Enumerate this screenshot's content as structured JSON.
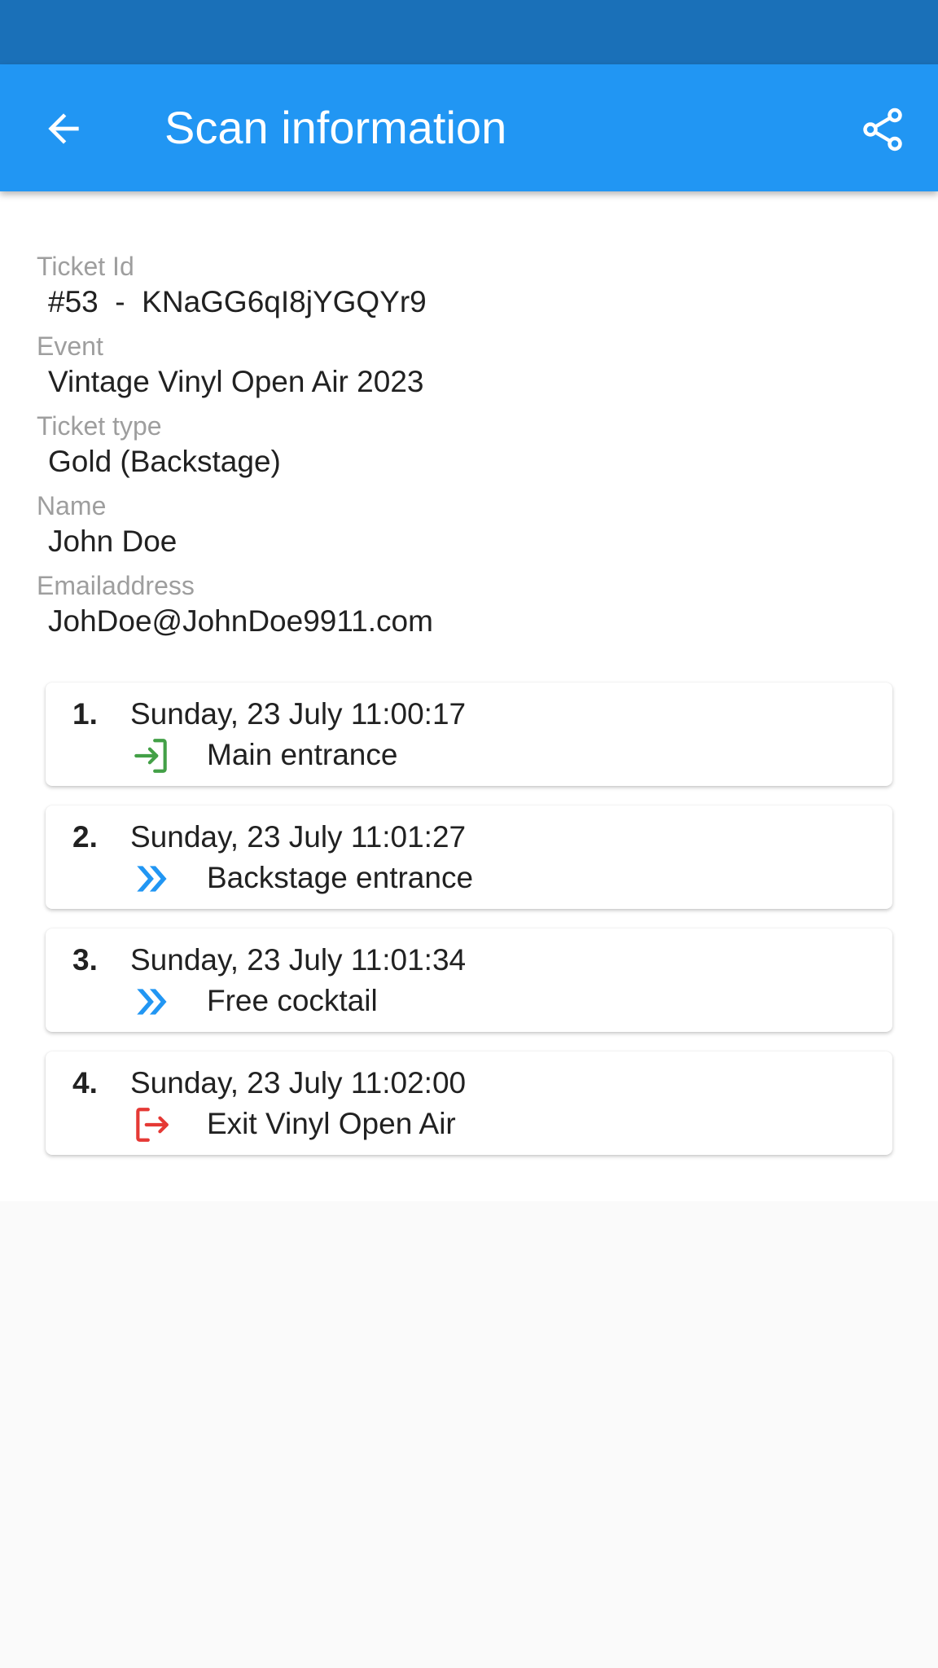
{
  "app_bar": {
    "title": "Scan information",
    "back_icon": "arrow-left-icon",
    "share_icon": "share-icon",
    "color": "#2196f3",
    "status_bar_color": "#1a70b8"
  },
  "fields": [
    {
      "label": "Ticket Id",
      "value": "#53  -  KNaGG6qI8jYGQYr9"
    },
    {
      "label": "Event",
      "value": "Vintage Vinyl Open Air 2023"
    },
    {
      "label": "Ticket type",
      "value": "Gold (Backstage)"
    },
    {
      "label": "Name",
      "value": "John Doe"
    },
    {
      "label": "Emailaddress",
      "value": "JohDoe@JohnDoe9911.com"
    }
  ],
  "scans": [
    {
      "index": "1.",
      "time": "Sunday, 23 July 11:00:17",
      "location": "Main entrance",
      "icon": "login-icon",
      "icon_color": "#43a047"
    },
    {
      "index": "2.",
      "time": "Sunday, 23 July 11:01:27",
      "location": "Backstage entrance",
      "icon": "double-chevron-right-icon",
      "icon_color": "#2196f3"
    },
    {
      "index": "3.",
      "time": "Sunday, 23 July 11:01:34",
      "location": "Free cocktail",
      "icon": "double-chevron-right-icon",
      "icon_color": "#2196f3"
    },
    {
      "index": "4.",
      "time": "Sunday, 23 July 11:02:00",
      "location": "Exit Vinyl Open Air",
      "icon": "logout-icon",
      "icon_color": "#e53935"
    }
  ]
}
